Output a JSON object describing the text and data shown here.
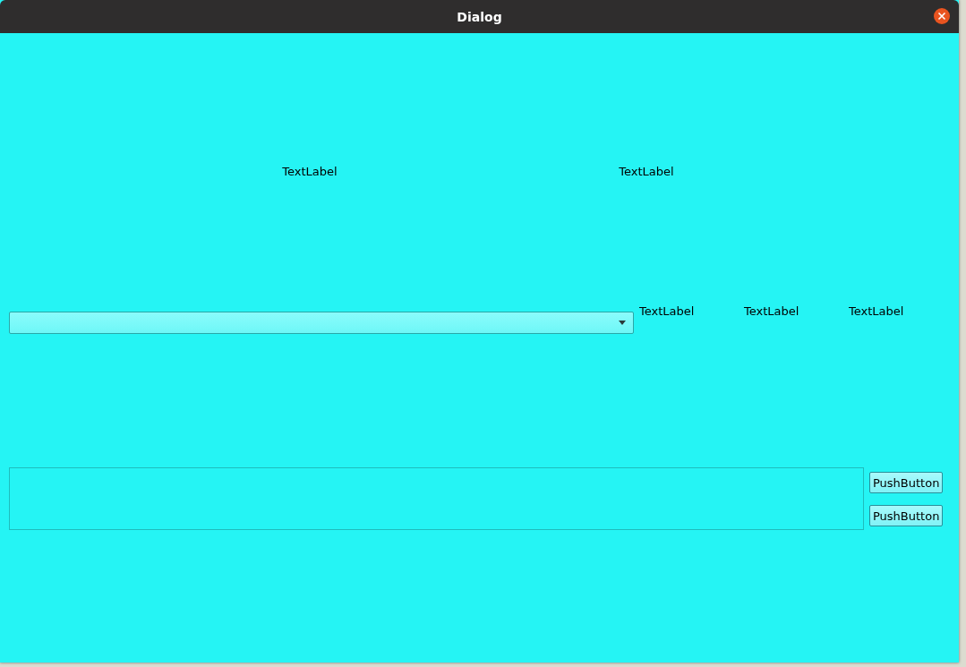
{
  "window": {
    "title": "Dialog"
  },
  "top_labels": [
    "TextLabel",
    "TextLabel"
  ],
  "middle_labels": [
    "TextLabel",
    "TextLabel",
    "TextLabel"
  ],
  "buttons": [
    "PushButton",
    "PushButton"
  ]
}
